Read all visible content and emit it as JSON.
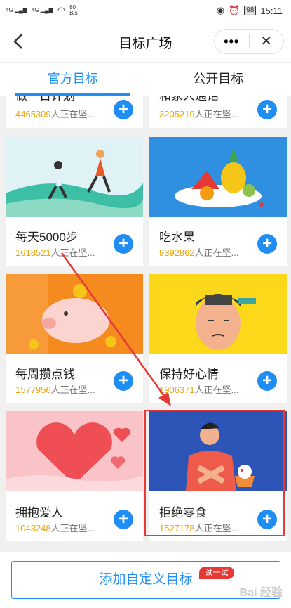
{
  "status": {
    "carrier_left": "4G",
    "carrier_right": "4G",
    "speed": "80",
    "speed_unit": "B/s",
    "battery": "98",
    "time": "15:11"
  },
  "nav": {
    "back": "‹",
    "title": "目标广场",
    "more": "•••",
    "close": "✕"
  },
  "tabs": [
    {
      "label": "官方目标",
      "active": true
    },
    {
      "label": "公开目标",
      "active": false
    }
  ],
  "count_suffix": "人正在坚...",
  "cards": [
    {
      "name": "做一日计划",
      "count": "4465309"
    },
    {
      "name": "和家人通话",
      "count": "3205219"
    },
    {
      "name": "每天5000步",
      "count": "1618521"
    },
    {
      "name": "吃水果",
      "count": "9392862"
    },
    {
      "name": "每周攒点钱",
      "count": "1577956"
    },
    {
      "name": "保持好心情",
      "count": "1906371"
    },
    {
      "name": "拥抱爱人",
      "count": "1043248"
    },
    {
      "name": "拒绝零食",
      "count": "1527178"
    }
  ],
  "add_button": "添加自定义目标",
  "trial_badge": "试一试",
  "watermark": "Bai 经验",
  "colors": {
    "accent": "#1e8ef5",
    "count": "#e8a30c",
    "highlight": "#e53935"
  }
}
